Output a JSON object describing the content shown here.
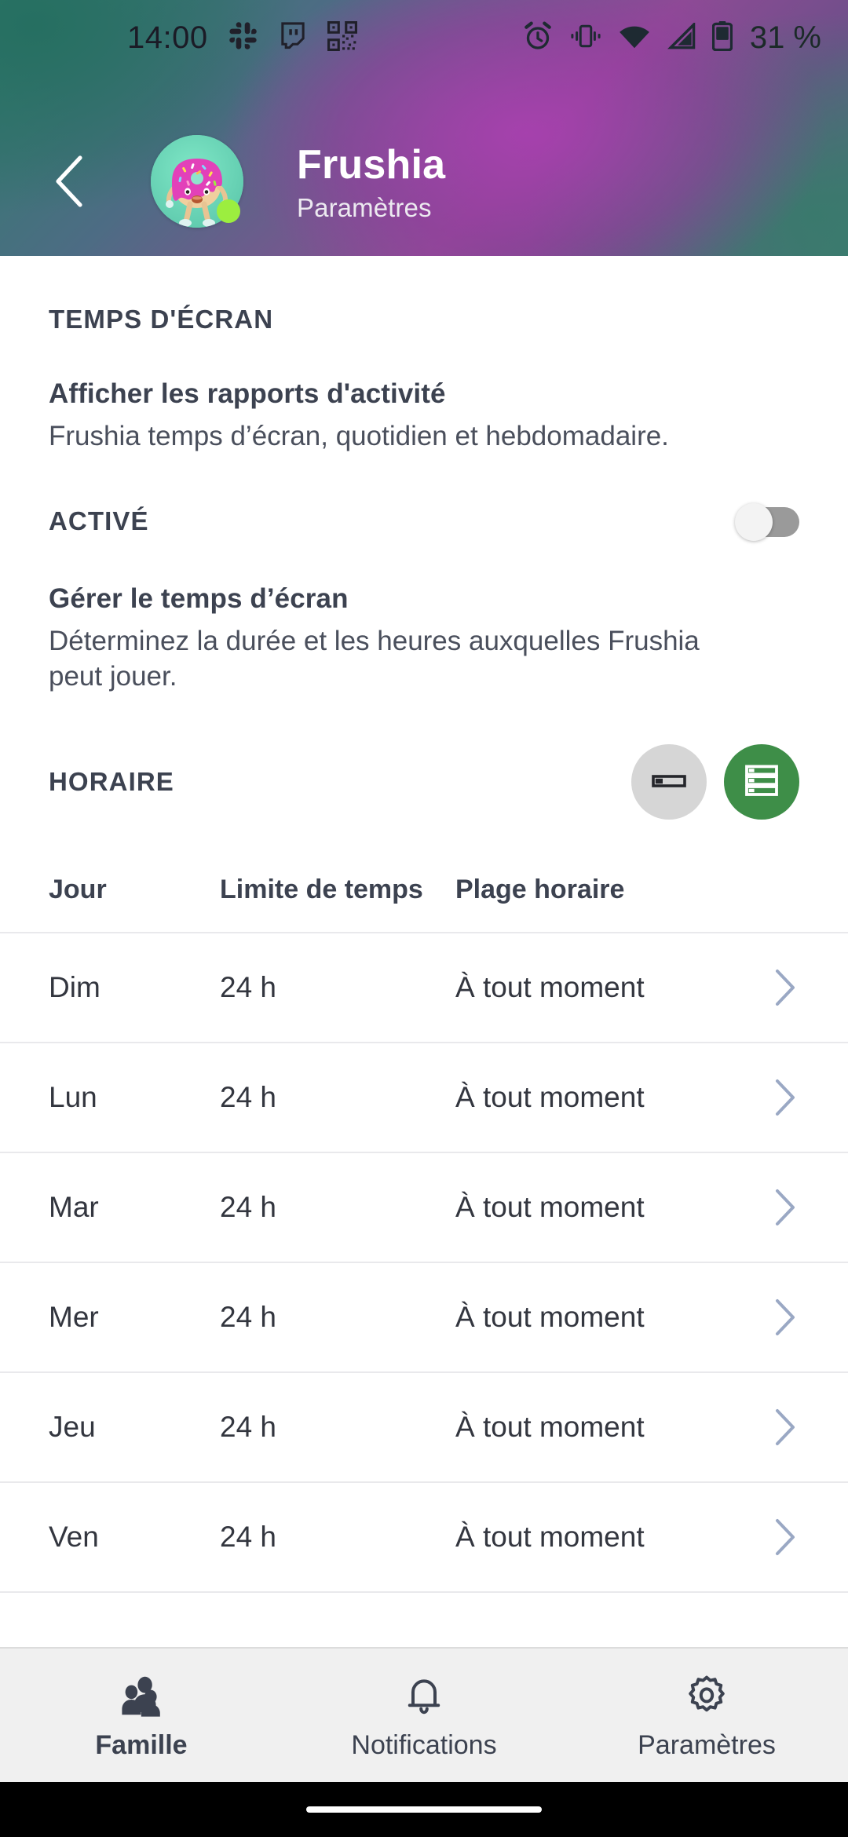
{
  "status_bar": {
    "time": "14:00",
    "battery_text": "31 %",
    "left_icons": [
      "slack-icon",
      "twitch-icon",
      "qr-code-icon"
    ],
    "right_icons": [
      "alarm-icon",
      "vibrate-icon",
      "wifi-icon",
      "cellular-signal-icon",
      "battery-icon"
    ]
  },
  "header": {
    "back_icon": "back-chevron-icon",
    "avatar_name": "donut-avatar",
    "title": "Frushia",
    "subtitle": "Paramètres",
    "online_dot_color": "#9cee3f"
  },
  "screen_time": {
    "section_label": "TEMPS D'ÉCRAN",
    "reports": {
      "title": "Afficher les rapports d'activité",
      "description": "Frushia temps d’écran, quotidien et hebdomadaire.",
      "toggle_label": "ACTIVÉ",
      "toggle_state": "off"
    },
    "manage": {
      "title": "Gérer le temps d’écran",
      "description": "Déterminez la durée et les heures auxquelles Frushia peut jouer."
    },
    "schedule": {
      "label": "HORAIRE",
      "modes": [
        {
          "name": "single-bar-view",
          "icon": "single-row-icon",
          "active": false,
          "color": "#d6d6d6"
        },
        {
          "name": "list-view",
          "icon": "list-rows-icon",
          "active": true,
          "color": "#3e8e48"
        }
      ]
    }
  },
  "table": {
    "columns": [
      "Jour",
      "Limite de temps",
      "Plage horaire"
    ],
    "rows": [
      {
        "day": "Dim",
        "limit": "24 h",
        "range": "À tout moment"
      },
      {
        "day": "Lun",
        "limit": "24 h",
        "range": "À tout moment"
      },
      {
        "day": "Mar",
        "limit": "24 h",
        "range": "À tout moment"
      },
      {
        "day": "Mer",
        "limit": "24 h",
        "range": "À tout moment"
      },
      {
        "day": "Jeu",
        "limit": "24 h",
        "range": "À tout moment"
      },
      {
        "day": "Ven",
        "limit": "24 h",
        "range": "À tout moment"
      }
    ]
  },
  "bottom_nav": {
    "items": [
      {
        "label": "Famille",
        "icon": "family-people-icon",
        "active": true
      },
      {
        "label": "Notifications",
        "icon": "bell-icon",
        "active": false
      },
      {
        "label": "Paramètres",
        "icon": "gear-icon",
        "active": false
      }
    ]
  }
}
